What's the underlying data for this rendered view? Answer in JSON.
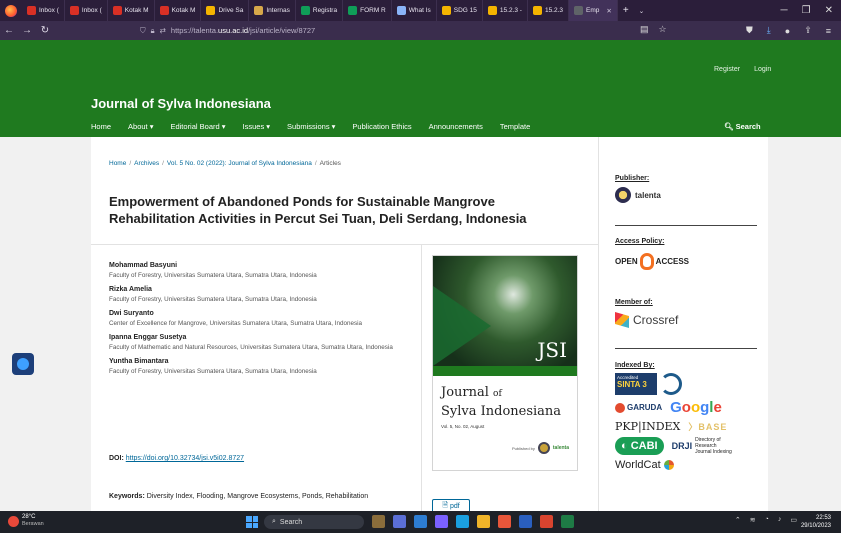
{
  "browser": {
    "tabs": [
      {
        "label": "Inbox (",
        "color": "#d93025"
      },
      {
        "label": "Inbox (",
        "color": "#d93025"
      },
      {
        "label": "Kotak M",
        "color": "#d93025"
      },
      {
        "label": "Kotak M",
        "color": "#d93025"
      },
      {
        "label": "Drive Sa",
        "color": "#f4b400"
      },
      {
        "label": "Internas",
        "color": "#d7a84a"
      },
      {
        "label": "Registra",
        "color": "#0f9d58"
      },
      {
        "label": "FORM R",
        "color": "#0f9d58"
      },
      {
        "label": "What Is",
        "color": "#8ab4f8"
      },
      {
        "label": "SDG 15",
        "color": "#f4b400"
      },
      {
        "label": "15.2.3 -",
        "color": "#f4b400"
      },
      {
        "label": "15.2.3",
        "color": "#f4b400"
      },
      {
        "label": "Emp",
        "color": "#5f6368"
      }
    ],
    "url_prefix": "https://talenta.",
    "url_domain": "usu.ac.id",
    "url_path": "/jsi/article/view/8727"
  },
  "header": {
    "register": "Register",
    "login": "Login",
    "journal_title": "Journal of Sylva Indonesiana",
    "nav": [
      "Home",
      "About ▾",
      "Editorial Board ▾",
      "Issues ▾",
      "Submissions ▾",
      "Publication Ethics",
      "Announcements",
      "Template"
    ],
    "search": "Search"
  },
  "breadcrumb": {
    "home": "Home",
    "archives": "Archives",
    "issue": "Vol. 5 No. 02 (2022): Journal of Sylva Indonesiana",
    "current": "Articles"
  },
  "article": {
    "title": "Empowerment of Abandoned Ponds for Sustainable Mangrove Rehabilitation Activities in Percut Sei Tuan, Deli Serdang, Indonesia",
    "authors": [
      {
        "name": "Mohammad Basyuni",
        "affiliation": "Faculty of Forestry, Universitas Sumatera Utara, Sumatra Utara, Indonesia"
      },
      {
        "name": "Rizka Amelia",
        "affiliation": "Faculty of Forestry, Universitas Sumatera Utara, Sumatra Utara, Indonesia"
      },
      {
        "name": "Dwi Suryanto",
        "affiliation": "Center of Excellence for Mangrove, Universitas Sumatera Utara, Sumatra Utara, Indonesia"
      },
      {
        "name": "Ipanna Enggar Susetya",
        "affiliation": "Faculty of Mathematic and Natural Resources, Universitas Sumatera Utara, Sumatra Utara, Indonesia"
      },
      {
        "name": "Yuntha Bimantara",
        "affiliation": "Faculty of Forestry, Universitas Sumatera Utara, Sumatra Utara, Indonesia"
      }
    ],
    "doi_label": "DOI:",
    "doi_link": "https://doi.org/10.32734/jsi.v5i02.8727",
    "keywords_label": "Keywords:",
    "keywords": "Diversity Index, Flooding, Mangrove Ecosystems, Ponds, Rehabilitation",
    "pdf_label": "pdf"
  },
  "cover": {
    "jsi": "JSI",
    "name_line1": "Journal",
    "name_of": "of",
    "name_line2": "Sylva Indonesiana",
    "issue": "Vol. 5, No. 02, August",
    "published_by": "Published by",
    "publisher_logo": "talenta"
  },
  "sidebar": {
    "publisher_title": "Publisher:",
    "publisher_logo": "talenta",
    "access_title": "Access Policy:",
    "open": "OPEN",
    "access": "ACCESS",
    "member_title": "Member of:",
    "crossref": "Crossref",
    "indexed_title": "Indexed By:",
    "sinta_accredited": "Accredited",
    "sinta": "SINTA 3",
    "garuda": "GARUDA",
    "pkp": "PKP|INDEX",
    "base": "BASE",
    "cabi": "CABI",
    "drji": "DRJI",
    "drji_full": "Directory of Research Journal Indexing",
    "worldcat": "WorldCat"
  },
  "taskbar": {
    "temp": "28°C",
    "weather": "Berawan",
    "search": "Search",
    "time": "22:53",
    "date": "29/10/2023"
  }
}
